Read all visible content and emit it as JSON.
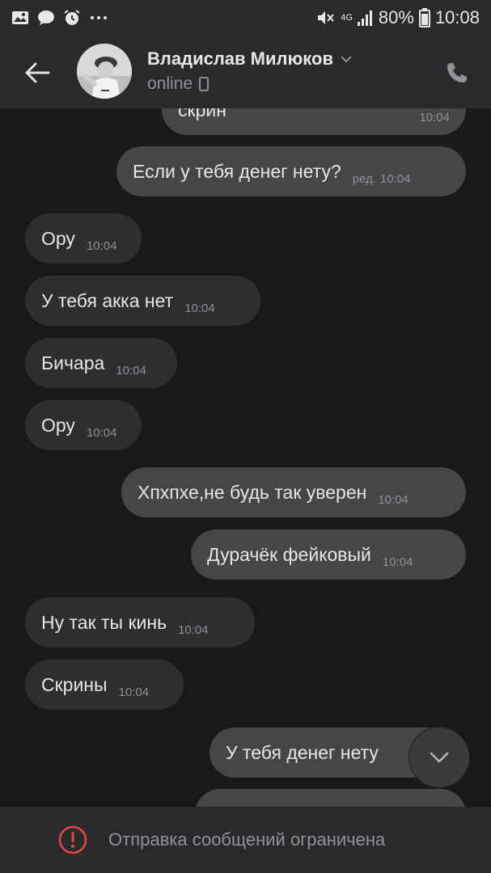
{
  "status_bar": {
    "battery_percent": "80%",
    "time": "10:08",
    "network": "4G",
    "left_icons": [
      "gallery-icon",
      "chat-icon",
      "alarm-icon",
      "more-dots-icon"
    ],
    "right_icons": [
      "mute-icon",
      "signal-icon",
      "battery-icon"
    ]
  },
  "header": {
    "contact_name": "Владислав Милюков",
    "status": "online",
    "icons": [
      "back-arrow-icon",
      "chevron-down-icon",
      "mobile-icon",
      "phone-icon"
    ]
  },
  "messages": [
    {
      "direction": "out",
      "text": "скрин",
      "time": "10:04",
      "edited": ""
    },
    {
      "direction": "out",
      "text": "Если у тебя денег нету?",
      "time": "10:04",
      "edited": "ред."
    },
    {
      "direction": "in",
      "text": "Ору",
      "time": "10:04",
      "edited": ""
    },
    {
      "direction": "in",
      "text": "У тебя акка нет",
      "time": "10:04",
      "edited": ""
    },
    {
      "direction": "in",
      "text": "Бичара",
      "time": "10:04",
      "edited": ""
    },
    {
      "direction": "in",
      "text": "Ору",
      "time": "10:04",
      "edited": ""
    },
    {
      "direction": "out",
      "text": "Хпхпхе,не будь так уверен",
      "time": "10:04",
      "edited": ""
    },
    {
      "direction": "out",
      "text": "Дурачёк фейковый",
      "time": "10:04",
      "edited": ""
    },
    {
      "direction": "in",
      "text": "Ну так ты кинь",
      "time": "10:04",
      "edited": ""
    },
    {
      "direction": "in",
      "text": "Скрины",
      "time": "10:04",
      "edited": ""
    },
    {
      "direction": "out",
      "text": "У тебя денег нету",
      "time": "",
      "edited": ""
    }
  ],
  "bottom_bar": {
    "restriction_text": "Отправка сообщений ограничена",
    "icon": "alert-circle-icon"
  },
  "colors": {
    "background": "#19191a",
    "bar": "#2a2a2c",
    "incoming_bubble": "#2e2e30",
    "outgoing_bubble": "#454647",
    "alert_red": "#e64646"
  }
}
